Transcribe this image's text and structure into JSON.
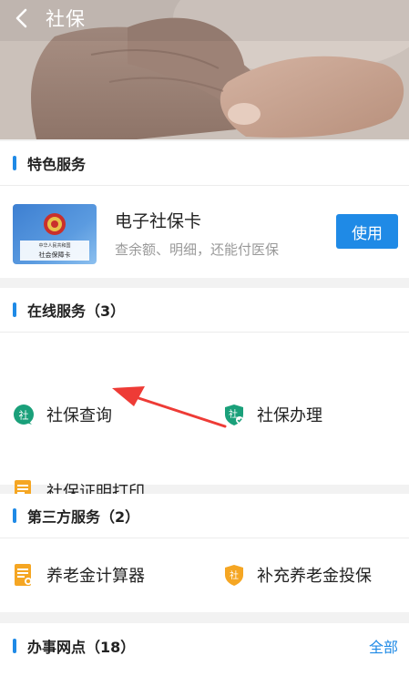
{
  "header": {
    "title": "社保"
  },
  "featured": {
    "section_title": "特色服务",
    "card": {
      "title": "电子社保卡",
      "subtitle": "查余额、明细，还能付医保",
      "button_label": "使用",
      "card_text_top": "中华人民共和国",
      "card_text_bottom": "社会保障卡"
    }
  },
  "online": {
    "section_title": "在线服务（3）",
    "items": [
      {
        "label": "社保查询",
        "icon": "social-security-query-icon"
      },
      {
        "label": "社保办理",
        "icon": "social-security-handle-icon"
      },
      {
        "label": "社保证明打印",
        "icon": "certificate-print-icon"
      }
    ],
    "badge_char": "社"
  },
  "third_party": {
    "section_title": "第三方服务（2）",
    "items": [
      {
        "label": "养老金计算器",
        "icon": "pension-calculator-icon"
      },
      {
        "label": "补充养老金投保",
        "icon": "supplementary-pension-icon"
      }
    ]
  },
  "offices": {
    "section_title": "办事网点（18）",
    "more_label": "全部"
  },
  "colors": {
    "accent": "#1f8ae6",
    "green": "#1aa07a",
    "orange": "#f5a623",
    "arrow": "#ee3b36"
  }
}
